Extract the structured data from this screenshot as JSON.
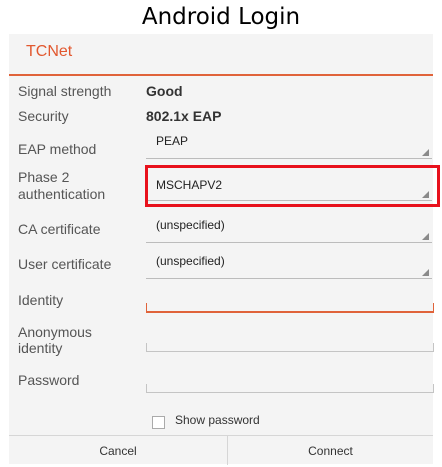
{
  "caption": "Android Login",
  "dialog": {
    "title": "TCNet",
    "signal_label": "Signal strength",
    "signal_value": "Good",
    "security_label": "Security",
    "security_value": "802.1x EAP",
    "eap_label": "EAP method",
    "eap_value": "PEAP",
    "phase2_label_line1": "Phase 2",
    "phase2_label_line2": "authentication",
    "phase2_value": "MSCHAPV2",
    "ca_label": "CA certificate",
    "ca_value": "(unspecified)",
    "user_cert_label": "User certificate",
    "user_cert_value": "(unspecified)",
    "identity_label": "Identity",
    "identity_value": "",
    "anon_label_line1": "Anonymous",
    "anon_label_line2": "identity",
    "anon_value": "",
    "password_label": "Password",
    "password_value": "",
    "show_password_label": "Show password",
    "show_password_checked": false,
    "cancel_label": "Cancel",
    "connect_label": "Connect"
  },
  "colors": {
    "accent": "#e0633a",
    "highlight": "#e8111c"
  },
  "icons": {
    "spinner_arrow": "triangle-down-right-icon"
  }
}
